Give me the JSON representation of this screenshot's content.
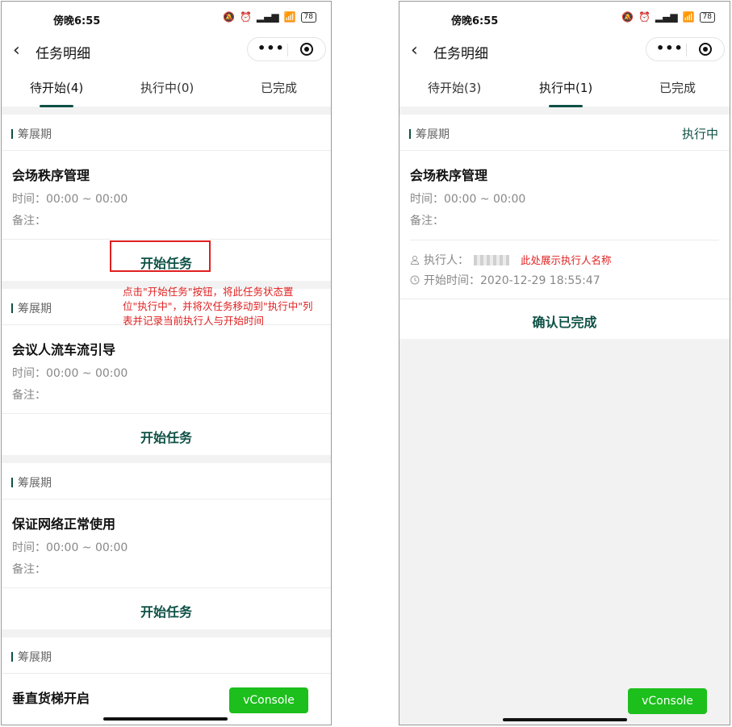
{
  "status": {
    "time": "傍晚6:55",
    "battery": "78"
  },
  "nav": {
    "title": "任务明细"
  },
  "left": {
    "tabs": [
      "待开始(4)",
      "执行中(0)",
      "已完成"
    ],
    "cards": [
      {
        "phase": "筹展期",
        "title": "会场秩序管理",
        "time_label": "时间：",
        "time": "00:00 ~ 00:00",
        "note_label": "备注：",
        "action": "开始任务"
      },
      {
        "phase": "筹展期",
        "title": "会议人流车流引导",
        "time_label": "时间：",
        "time": "00:00 ~ 00:00",
        "note_label": "备注：",
        "action": "开始任务"
      },
      {
        "phase": "筹展期",
        "title": "保证网络正常使用",
        "time_label": "时间：",
        "time": "00:00 ~ 00:00",
        "note_label": "备注：",
        "action": "开始任务"
      },
      {
        "phase": "筹展期",
        "title": "垂直货梯开启"
      }
    ],
    "annotation": "点击\"开始任务\"按钮，将此任务状态置位\"执行中\"，并将次任务移动到\"执行中\"列表并记录当前执行人与开始时间"
  },
  "right": {
    "tabs": [
      "待开始(3)",
      "执行中(1)",
      "已完成"
    ],
    "card": {
      "phase": "筹展期",
      "state": "执行中",
      "title": "会场秩序管理",
      "time_label": "时间：",
      "time": "00:00 ~ 00:00",
      "note_label": "备注：",
      "executor_label": "执行人：",
      "executor_annotation": "此处展示执行人名称",
      "start_label": "开始时间：",
      "start_time": "2020-12-29 18:55:47",
      "action": "确认已完成"
    }
  },
  "vconsole": "vConsole",
  "colors": {
    "accent": "#0e5146",
    "annotation": "#e02020",
    "vconsole": "#1cbf1c"
  }
}
